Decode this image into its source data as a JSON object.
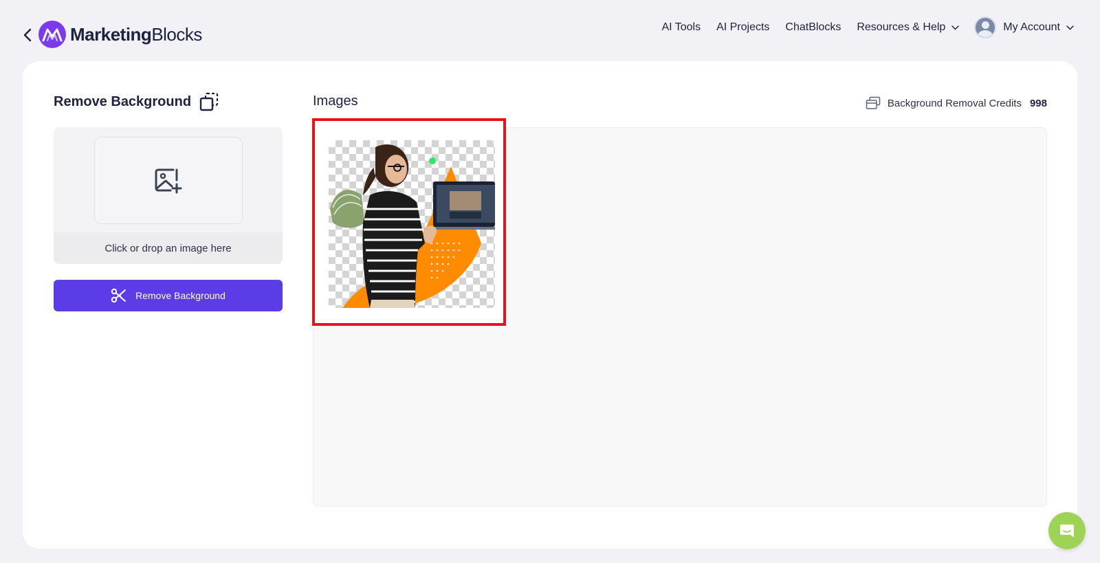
{
  "brand": {
    "name_bold": "Marketing",
    "name_light": "Blocks",
    "accent_color": "#7c3aed"
  },
  "nav": {
    "items": [
      {
        "label": "AI Tools"
      },
      {
        "label": "AI Projects"
      },
      {
        "label": "ChatBlocks"
      },
      {
        "label": "Resources & Help",
        "has_dropdown": true
      }
    ],
    "account": {
      "label": "My Account",
      "has_dropdown": true
    }
  },
  "tool": {
    "title": "Remove Background",
    "icon": "dashed-square-icon",
    "upload": {
      "icon": "image-add-icon",
      "hint": "Click or drop an image here"
    },
    "action_button": {
      "label": "Remove Background",
      "icon": "scissors-icon",
      "color": "#5b3ce6"
    }
  },
  "images_panel": {
    "title": "Images",
    "credits_label": "Background Removal Credits",
    "credits_count": "998",
    "credits_icon": "stacked-cards-icon",
    "selected_highlight_color": "#e8121b",
    "items": [
      {
        "type": "image",
        "description_icon": "transparent-background-thumbnail",
        "selected": true
      }
    ]
  },
  "chat_widget": {
    "icon": "chat-icon",
    "color": "#9fd356"
  }
}
